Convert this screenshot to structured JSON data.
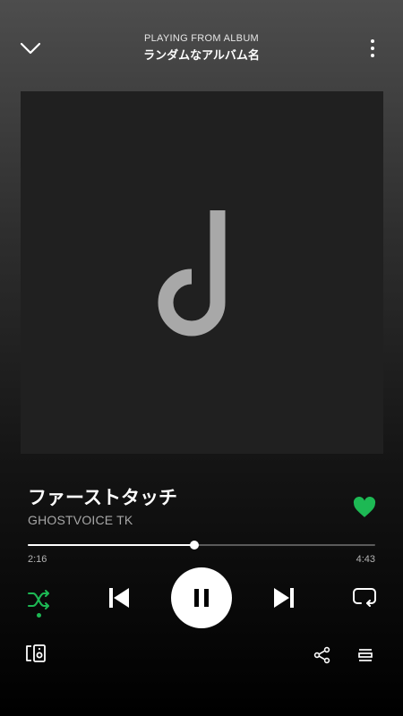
{
  "header": {
    "context_label": "PLAYING FROM ALBUM",
    "album_name": "ランダムなアルバム名"
  },
  "track": {
    "title": "ファーストタッチ",
    "artist": "GHOSTVOICE TK",
    "liked": true
  },
  "playback": {
    "elapsed": "2:16",
    "duration": "4:43",
    "progress_fraction": 0.48,
    "is_playing": true,
    "shuffle_on": true,
    "repeat_on": false
  },
  "colors": {
    "accent": "#1db954",
    "icon": "#ffffff",
    "subtext": "#a7a7a7"
  },
  "icons": {
    "collapse": "chevron-down",
    "more": "more-vertical",
    "like": "heart",
    "shuffle": "shuffle",
    "previous": "skip-previous",
    "pause": "pause",
    "next": "skip-next",
    "repeat": "repeat",
    "devices": "connect-devices",
    "share": "share",
    "queue": "queue"
  }
}
